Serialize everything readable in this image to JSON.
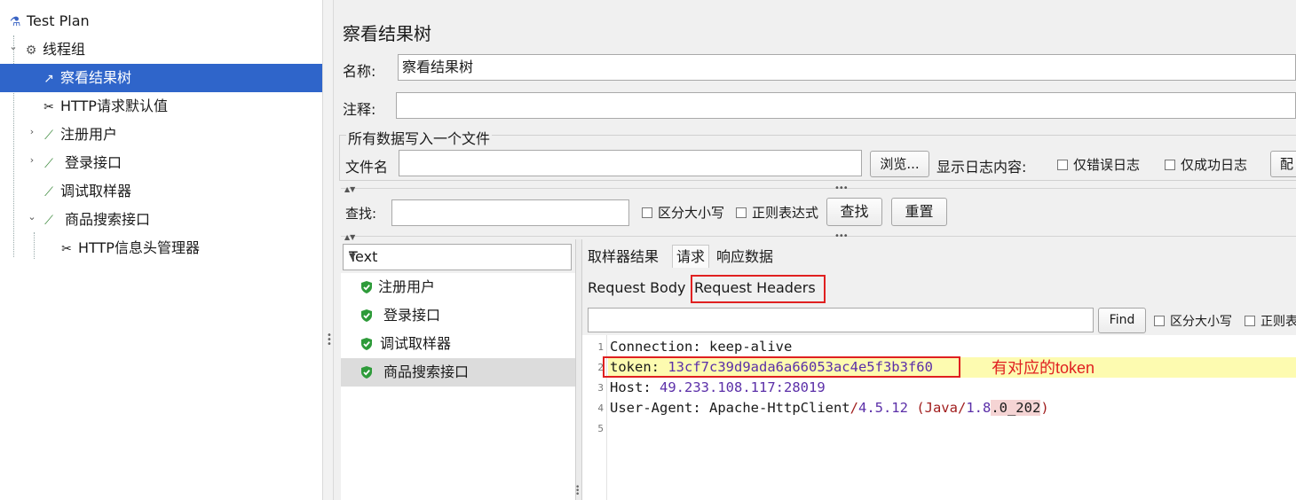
{
  "tree": {
    "items": [
      {
        "label": "Test Plan",
        "icon": "flask-icon"
      },
      {
        "label": "线程组",
        "icon": "gear-icon"
      },
      {
        "label": "察看结果树",
        "icon": "chart-icon"
      },
      {
        "label": "HTTP请求默认值",
        "icon": "wrench-icon"
      },
      {
        "label": "注册用户",
        "icon": "pipette-icon"
      },
      {
        "label": "登录接口",
        "icon": "pipette-icon"
      },
      {
        "label": "调试取样器",
        "icon": "pipette-icon"
      },
      {
        "label": "商品搜索接口",
        "icon": "pipette-icon"
      },
      {
        "label": "HTTP信息头管理器",
        "icon": "wrench-icon"
      }
    ],
    "selected_index": 2
  },
  "panel": {
    "title": "察看结果树",
    "name_label": "名称:",
    "name_value": "察看结果树",
    "comment_label": "注释:",
    "comment_value": "",
    "file_section_title": "所有数据写入一个文件",
    "filename_label": "文件名",
    "filename_value": "",
    "browse_button": "浏览...",
    "log_display_label": "显示日志内容:",
    "errors_only": "仅错误日志",
    "success_only": "仅成功日志",
    "config_button_partial": "配",
    "search_label": "查找:",
    "search_value": "",
    "case_sensitive": "区分大小写",
    "regex": "正则表达式",
    "find_button": "查找",
    "reset_button": "重置"
  },
  "results": {
    "renderer": "Text",
    "items": [
      "注册用户",
      "登录接口",
      "调试取样器",
      "商品搜索接口"
    ],
    "selected_index": 3
  },
  "detail": {
    "tabs": [
      "取样器结果",
      "请求",
      "响应数据"
    ],
    "active_tab": "请求",
    "subtabs": [
      "Request Body",
      "Request Headers"
    ],
    "active_subtab": "Request Headers",
    "find_button": "Find",
    "case_sensitive": "区分大小写",
    "regex_partial": "正则表",
    "lines": [
      {
        "num": "1",
        "key": "Connection:",
        "value": "keep-alive"
      },
      {
        "num": "2",
        "key": "token:",
        "value": "13cf7c39d9ada6a66053ac4e5f3b3f60"
      },
      {
        "num": "3",
        "key": "Host:",
        "value": "49.233.108.117:28019"
      },
      {
        "num": "4",
        "key": "User-Agent:",
        "value_a": "Apache-HttpClient",
        "value_b": "/",
        "value_c": "4.5.12",
        "value_d": " (Java/",
        "value_e": "1.8",
        "value_f": ".0_202",
        "value_g": ")"
      },
      {
        "num": "5",
        "key": "",
        "value": ""
      }
    ],
    "annotation": "有对应的token"
  },
  "colors": {
    "selection": "#2f65ca",
    "highlight_line": "#fdfbb0",
    "annotation_red": "#e02020"
  }
}
